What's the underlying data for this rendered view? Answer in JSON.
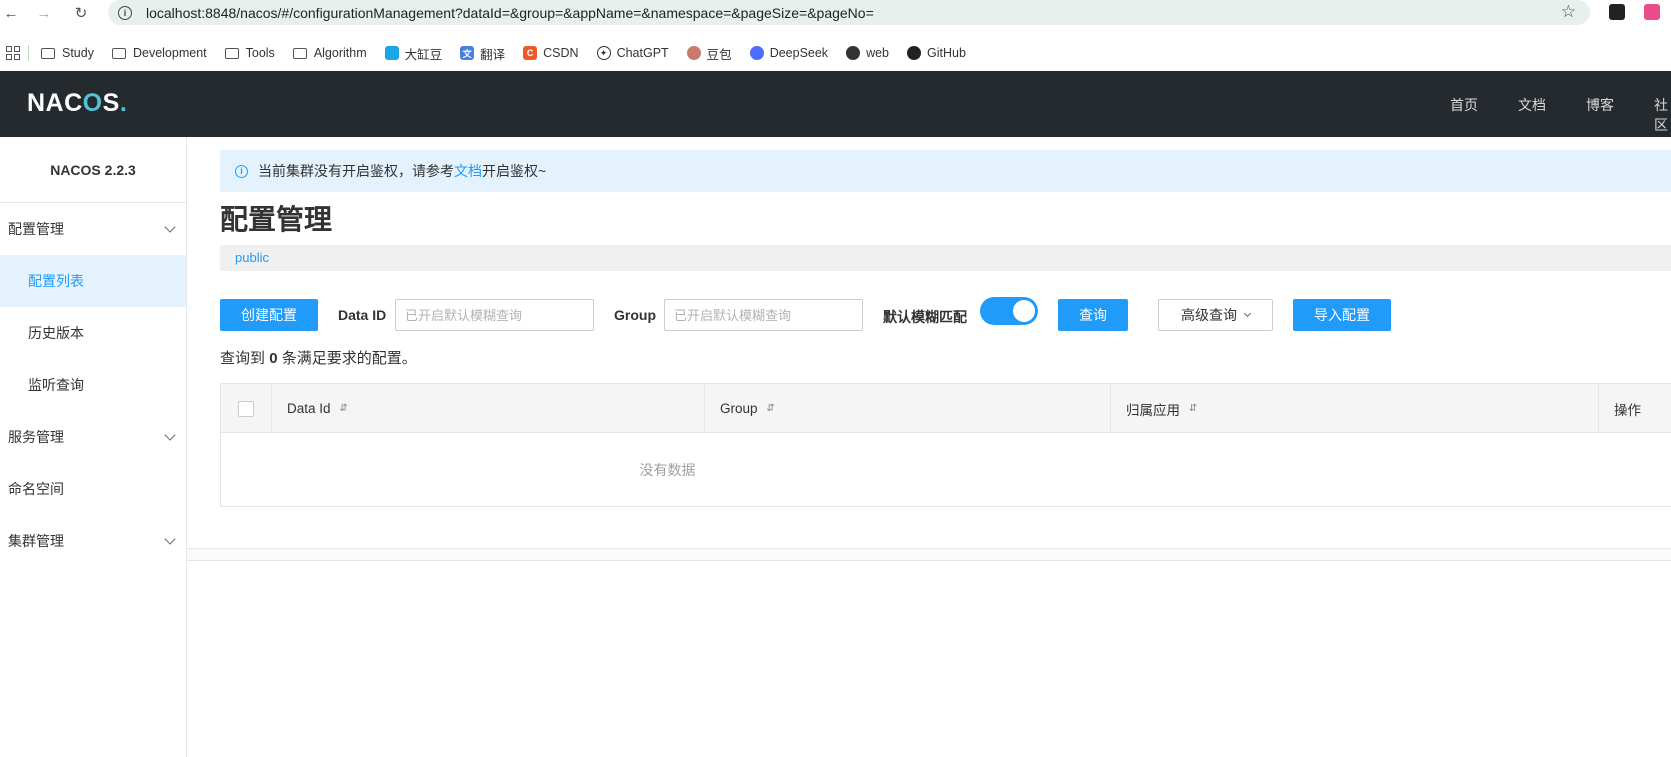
{
  "browser": {
    "url": "localhost:8848/nacos/#/configurationManagement?dataId=&group=&appName=&namespace=&pageSize=&pageNo=",
    "bookmarks": [
      {
        "label": "Study",
        "type": "folder"
      },
      {
        "label": "Development",
        "type": "folder"
      },
      {
        "label": "Tools",
        "type": "folder"
      },
      {
        "label": "Algorithm",
        "type": "folder"
      },
      {
        "label": "大缸豆",
        "type": "site",
        "color": "#1aa7e8"
      },
      {
        "label": "翻译",
        "type": "site",
        "color": "#4a7fdc"
      },
      {
        "label": "CSDN",
        "type": "site",
        "color": "#f05a28"
      },
      {
        "label": "ChatGPT",
        "type": "site",
        "color": "#333333"
      },
      {
        "label": "豆包",
        "type": "site",
        "color": "#c97a6a"
      },
      {
        "label": "DeepSeek",
        "type": "site",
        "color": "#4d6bfe"
      },
      {
        "label": "web",
        "type": "site",
        "color": "#333333"
      },
      {
        "label": "GitHub",
        "type": "site",
        "color": "#222222"
      }
    ]
  },
  "header": {
    "logo": "NACOS",
    "nav": [
      "首页",
      "文档",
      "博客",
      "社区"
    ]
  },
  "sidebar": {
    "version": "NACOS 2.2.3",
    "groups": [
      {
        "label": "配置管理",
        "items": [
          "配置列表",
          "历史版本",
          "监听查询"
        ]
      },
      {
        "label": "服务管理"
      },
      {
        "label": "命名空间"
      },
      {
        "label": "集群管理"
      }
    ]
  },
  "alert": {
    "text_before": "当前集群没有开启鉴权，请参考",
    "link": "文档",
    "text_after": "开启鉴权~"
  },
  "page": {
    "title": "配置管理",
    "namespace": "public"
  },
  "toolbar": {
    "create_label": "创建配置",
    "dataid_label": "Data ID",
    "dataid_placeholder": "已开启默认模糊查询",
    "group_label": "Group",
    "group_placeholder": "已开启默认模糊查询",
    "fuzzy_label": "默认模糊匹配",
    "fuzzy_on": true,
    "query_label": "查询",
    "advanced_label": "高级查询",
    "import_label": "导入配置"
  },
  "result": {
    "prefix": "查询到",
    "count": "0",
    "suffix": "条满足要求的配置。"
  },
  "table": {
    "columns": [
      "Data Id",
      "Group",
      "归属应用",
      "操作"
    ],
    "empty_text": "没有数据"
  }
}
